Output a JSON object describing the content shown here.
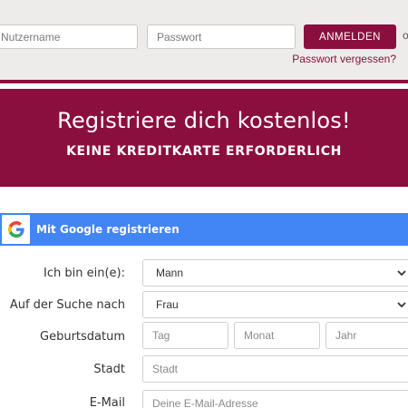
{
  "login": {
    "username_placeholder": "Nutzername",
    "password_placeholder": "Passwort",
    "login_button": "ANMELDEN",
    "extra_text": "o",
    "forgot_link": "Passwort vergessen?"
  },
  "banner": {
    "title": "Registriere dich kostenlos!",
    "subtitle": "KEINE KREDITKARTE ERFORDERLICH"
  },
  "google": {
    "label": "Mit Google registrieren",
    "icon": "google-g-icon"
  },
  "form": {
    "gender_label": "Ich bin ein(e):",
    "gender_value": "Mann",
    "seeking_label": "Auf der Suche nach",
    "seeking_value": "Frau",
    "birthdate_label": "Geburtsdatum",
    "day_placeholder": "Tag",
    "month_placeholder": "Monat",
    "year_placeholder": "Jahr",
    "city_label": "Stadt",
    "city_placeholder": "Stadt",
    "email_label": "E-Mail",
    "email_placeholder": "Deine E-Mail-Adresse"
  },
  "colors": {
    "brand": "#8b0f3e",
    "google_blue": "#4285f4",
    "login_bar_bg": "#eeecea"
  }
}
